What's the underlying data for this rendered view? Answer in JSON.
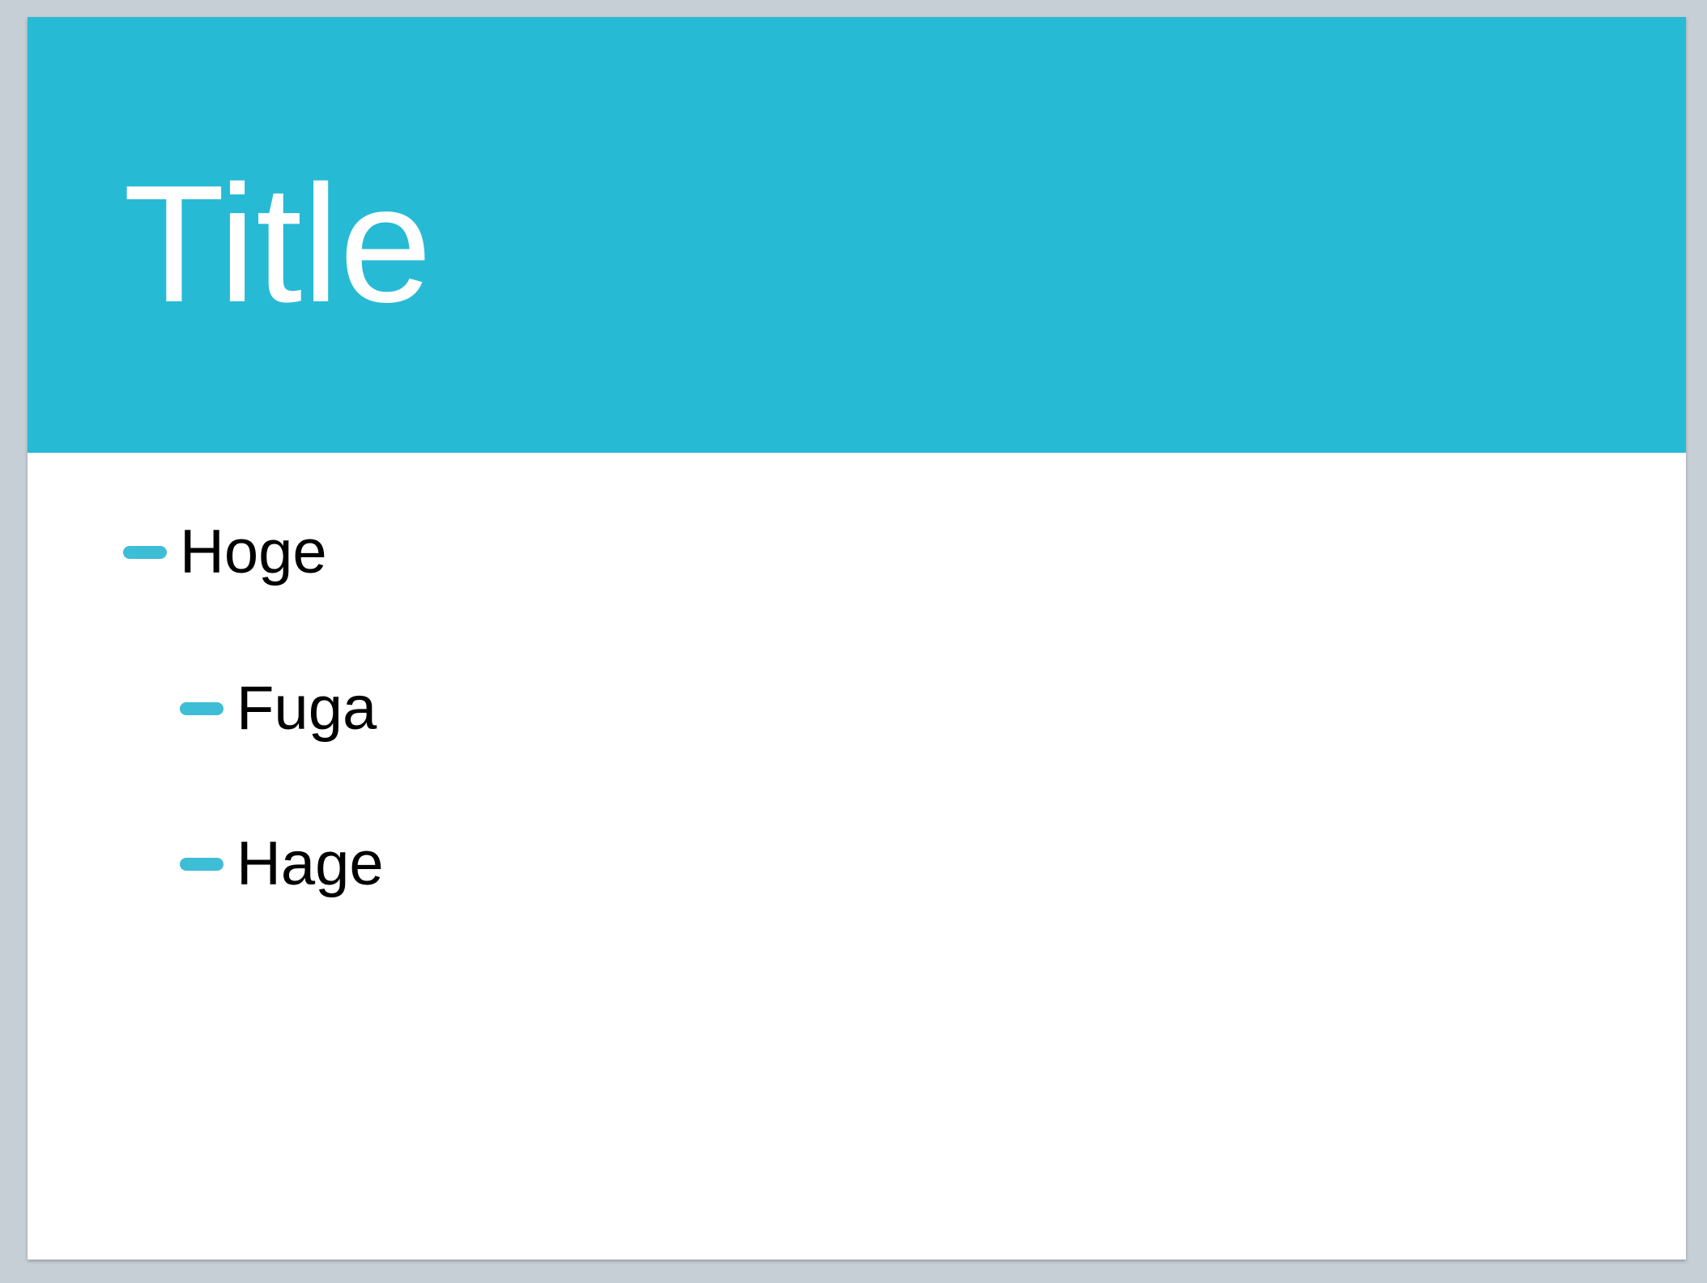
{
  "slide": {
    "title": "Title",
    "bullets": [
      {
        "label": "Hoge",
        "level": 1
      },
      {
        "label": "Fuga",
        "level": 2
      },
      {
        "label": "Hage",
        "level": 2
      }
    ]
  },
  "colors": {
    "accent": "#27bad5",
    "bullet": "#3ebdd6",
    "background": "#c6ced6",
    "slide": "#ffffff"
  },
  "icons": {
    "bullet_marker": "dash-bullet-icon"
  }
}
